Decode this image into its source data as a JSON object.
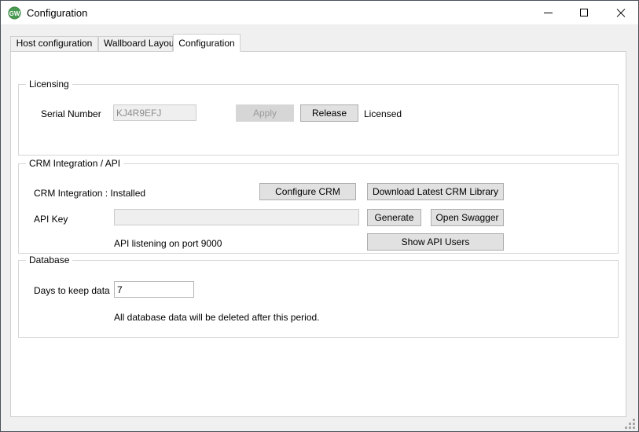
{
  "window": {
    "title": "Configuration",
    "icon": "app-logo-gw",
    "icon_text": "GW",
    "icon_color": "#4a9b52",
    "controls": {
      "minimize": "minimize-icon",
      "maximize": "maximize-icon",
      "close": "close-icon"
    }
  },
  "tabs": [
    {
      "id": "host",
      "label": "Host configuration",
      "selected": false
    },
    {
      "id": "wall",
      "label": "Wallboard Layouts",
      "selected": false
    },
    {
      "id": "conf",
      "label": "Configuration",
      "selected": true
    }
  ],
  "licensing": {
    "title": "Licensing",
    "serial_label": "Serial Number",
    "serial_value": "KJ4R9EFJ",
    "serial_disabled": true,
    "apply_label": "Apply",
    "apply_disabled": true,
    "release_label": "Release",
    "status": "Licensed"
  },
  "crm": {
    "title": "CRM Integration / API",
    "integration_status": "CRM Integration : Installed",
    "configure_label": "Configure CRM",
    "download_label": "Download Latest CRM Library",
    "api_key_label": "API Key",
    "api_key_value": "",
    "api_key_disabled": true,
    "generate_label": "Generate",
    "swagger_label": "Open Swagger",
    "listening_text": "API listening on port 9000",
    "show_users_label": "Show API Users"
  },
  "database": {
    "title": "Database",
    "days_label": "Days to keep data",
    "days_value": "7",
    "note": "All database data will be deleted after this period."
  }
}
